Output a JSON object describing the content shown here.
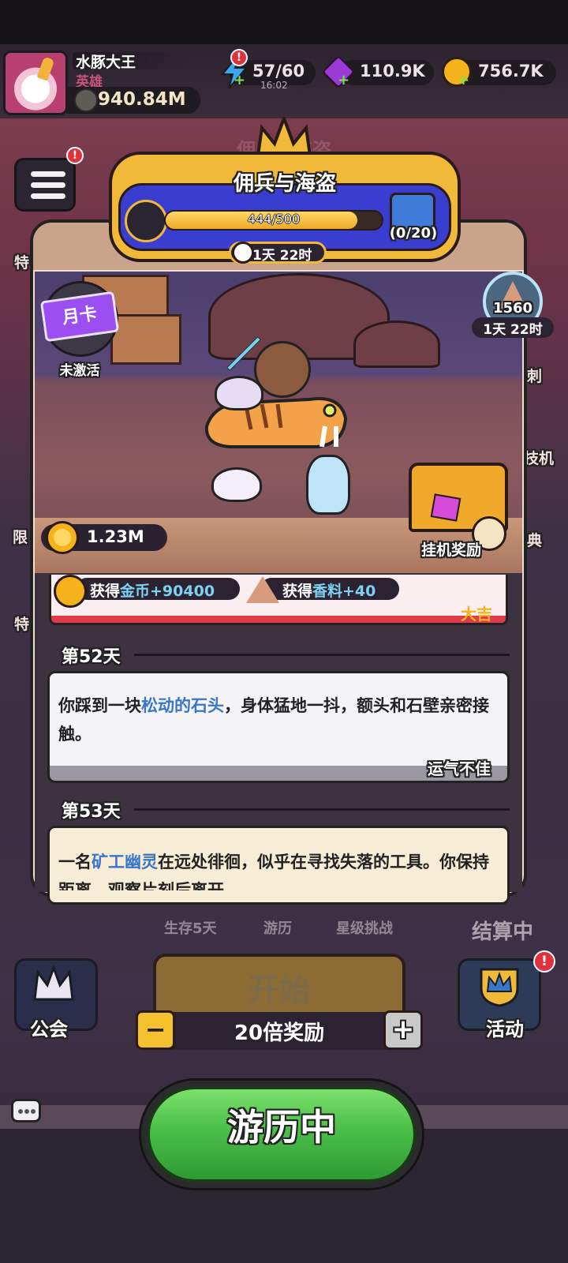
{
  "player": {
    "name": "水豚大王",
    "rank": "英雄",
    "power": "940.84M"
  },
  "resources": {
    "energy": "57/60",
    "energy_timer": "16:02",
    "energy_badge": "!",
    "gems": "110.9K",
    "coins": "756.7K"
  },
  "menu": {
    "badge": "!"
  },
  "event": {
    "title": "佣兵与海盗",
    "progress_text": "444/500",
    "progress_value": 444,
    "progress_max": 500,
    "gift_count": "(0/20)",
    "timer": "1天 22时"
  },
  "scene": {
    "month_card_label": "月卡",
    "month_card_status": "未激活",
    "spice_count": "1560",
    "spice_timer": "1天 22时",
    "coin_pool": "1.23M",
    "idle_reward_label": "挂机奖励"
  },
  "side_labels": {
    "left": [
      "特",
      "限",
      "特"
    ],
    "right": [
      "刺",
      "技机",
      "典"
    ]
  },
  "log": {
    "entry1": {
      "reward1_prefix": "获得",
      "reward1_highlight": "金币+90400",
      "reward2_prefix": "获得",
      "reward2_highlight": "香料+40",
      "luck": "大吉"
    },
    "entry2": {
      "day": "第52天",
      "text_before": "你踩到一块",
      "text_highlight": "松动的石头",
      "text_after": "，身体猛地一抖，额头和石壁亲密接触。",
      "luck": "运气不佳"
    },
    "entry3": {
      "day": "第53天",
      "text_before": "一名",
      "text_highlight": "矿工幽灵",
      "text_after": "在远处徘徊，似乎在寻找失落的工具。你保持距离，观察片刻后离开。"
    }
  },
  "bottom": {
    "tabs": [
      "生存5天",
      "游历",
      "星级挑战"
    ],
    "settling": "结算中",
    "guild_label": "公会",
    "activity_label": "活动",
    "activity_badge": "!",
    "start_label": "开始",
    "minus_label": "−",
    "plus_label": "+",
    "multiplier_label": "20倍奖励",
    "explore_label": "游历中"
  },
  "colors": {
    "accent_gold": "#f1b93a",
    "event_blue": "#3a3ed0",
    "explore_green": "#4bbf48",
    "luck_good": "#f5b21b",
    "badge_red": "#e0323c"
  }
}
